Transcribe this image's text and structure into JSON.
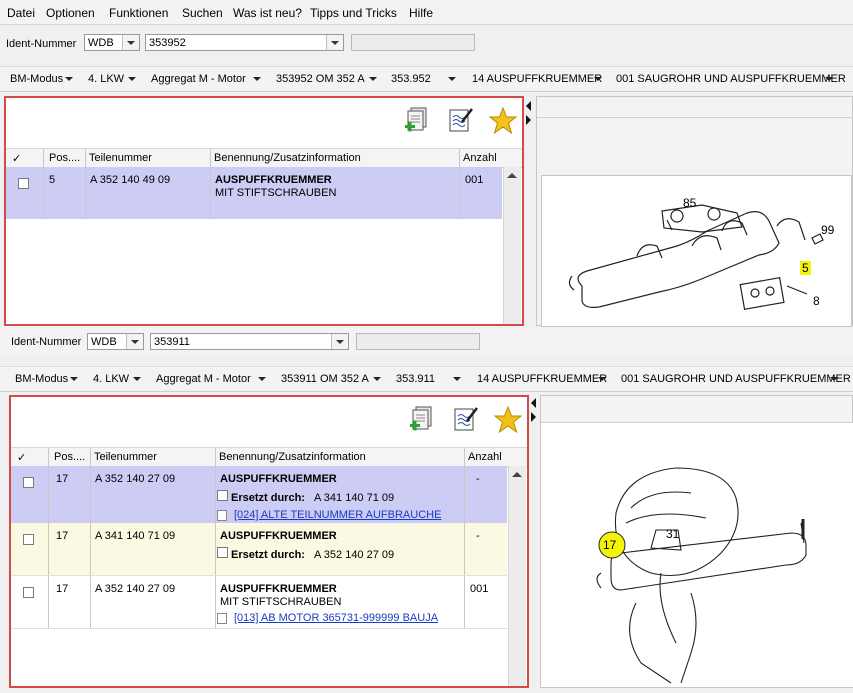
{
  "menu": {
    "items": [
      "Datei",
      "Optionen",
      "Funktionen",
      "Suchen",
      "Was ist neu?",
      "Tipps und Tricks",
      "Hilfe"
    ]
  },
  "top": {
    "ident_label": "Ident-Nummer",
    "prefix": "WDB",
    "number": "353952",
    "crumbs": [
      "BM-Modus",
      "4. LKW",
      "Aggregat M  - Motor",
      "353952 OM 352 A",
      "353.952",
      "14 AUSPUFFKRUEMMER",
      "001 SAUGROHR UND AUSPUFFKRUEMMER"
    ],
    "table": {
      "headers": [
        "✓",
        "Pos....",
        "Teilenummer",
        "Benennung/Zusatzinformation",
        "Anzahl"
      ],
      "rows": [
        {
          "pos": "5",
          "part": "A 352 140 49 09",
          "name": "AUSPUFFKRUEMMER",
          "info": "MIT STIFTSCHRAUBEN",
          "qty": "001"
        }
      ]
    },
    "drawing_labels": [
      "85",
      "99",
      "5",
      "8"
    ]
  },
  "bottom": {
    "ident_label": "Ident-Nummer",
    "prefix": "WDB",
    "number": "353911",
    "crumbs": [
      "BM-Modus",
      "4. LKW",
      "Aggregat M  - Motor",
      "353911 OM 352 A",
      "353.911",
      "14 AUSPUFFKRUEMMER",
      "001 SAUGROHR UND AUSPUFFKRUEMMER"
    ],
    "table": {
      "headers": [
        "✓",
        "Pos....",
        "Teilenummer",
        "Benennung/Zusatzinformation",
        "Anzahl"
      ],
      "rows": [
        {
          "pos": "17",
          "part": "A 352 140 27 09",
          "name": "AUSPUFFKRUEMMER",
          "replaced_label": "Ersetzt durch:",
          "replaced_value": "A 341 140 71 09",
          "link": "[024] ALTE TEILNUMMER AUFBRAUCHE",
          "qty": "-"
        },
        {
          "pos": "17",
          "part": "A 341 140 71 09",
          "name": "AUSPUFFKRUEMMER",
          "replaced_label": "Ersetzt durch:",
          "replaced_value": "A 352 140 27 09",
          "qty": "-"
        },
        {
          "pos": "17",
          "part": "A 352 140 27 09",
          "name": "AUSPUFFKRUEMMER",
          "info": "MIT STIFTSCHRAUBEN",
          "link": "[013] AB MOTOR 365731-999999 BAUJA",
          "qty": "001"
        }
      ]
    },
    "drawing_labels": [
      "17",
      "31"
    ]
  },
  "icons": [
    "add-document-icon",
    "edit-notes-icon",
    "star-icon"
  ],
  "colors": {
    "selected_row": "#ccccf5",
    "alt_row": "#fbf9e2",
    "panel_border": "#d24a4a",
    "highlight_label": "#f4f40a",
    "link": "#1a3dbf"
  }
}
